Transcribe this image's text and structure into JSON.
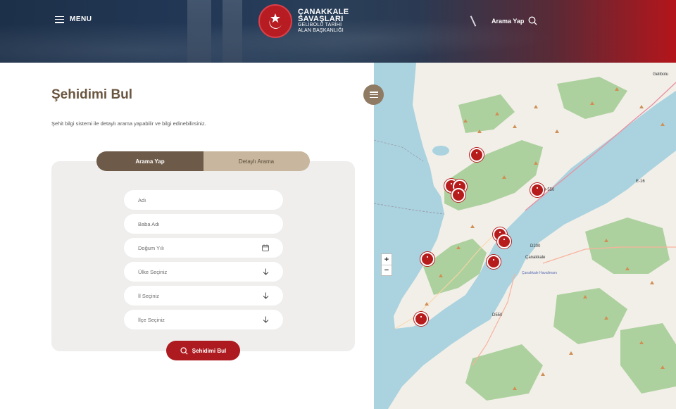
{
  "header": {
    "menu_label": "MENU",
    "logo_line1": "ÇANAKKALE",
    "logo_line2": "SAVAŞLARI",
    "logo_line3": "GELİBOLU TARİHİ",
    "logo_line4": "ALAN BAŞKANLIĞI",
    "search_label": "Arama Yap"
  },
  "page": {
    "title": "Şehidimi Bul",
    "description": "Şehit bilgi sistemi ile detaylı arama yapabilir ve bilgi edinebilirsiniz."
  },
  "tabs": [
    {
      "label": "Arama Yap",
      "active": true
    },
    {
      "label": "Detaylı Arama",
      "active": false
    }
  ],
  "form": {
    "name_placeholder": "Adı",
    "father_placeholder": "Baba Adı",
    "birth_placeholder": "Doğum Yılı",
    "country_placeholder": "Ülke Seçiniz",
    "province_placeholder": "İl Seçiniz",
    "district_placeholder": "İlçe Seçiniz",
    "submit_label": "Şehidimi Bul"
  },
  "map": {
    "zoom_in": "+",
    "zoom_out": "−",
    "city_label": "Çanakkale",
    "road_d550": "D-550",
    "road_d200": "D200",
    "road_d550b": "D550",
    "road_e": "E-16",
    "city_sub": "Çanakkale Havalimanı",
    "town_label": "Gelibolu"
  },
  "colors": {
    "brand_red": "#ad1a1f",
    "brown": "#6e5a48",
    "tan": "#c8b79e",
    "title_brown": "#6b5640"
  }
}
